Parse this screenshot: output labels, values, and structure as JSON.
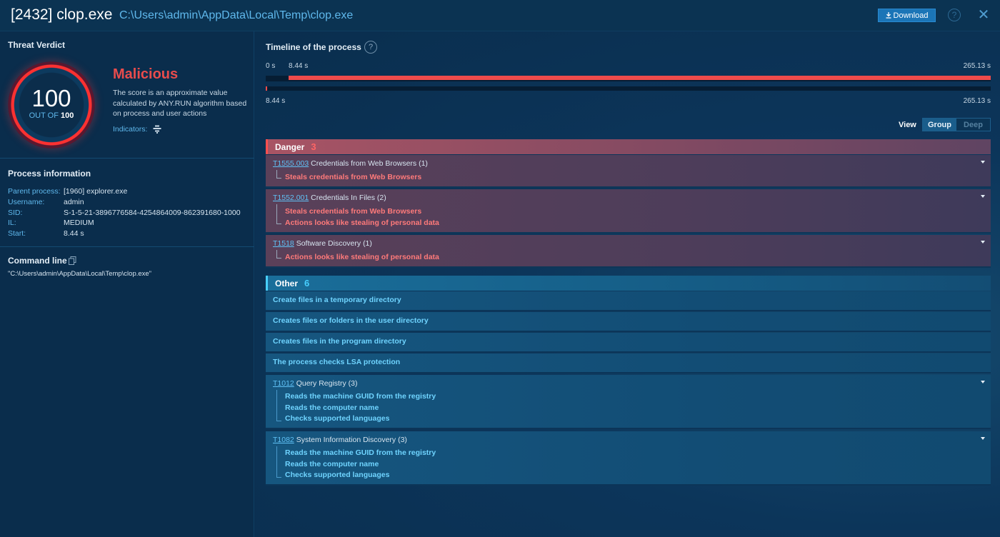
{
  "header": {
    "title": "[2432] clop.exe",
    "path": "C:\\Users\\admin\\AppData\\Local\\Temp\\clop.exe",
    "download_label": "Download",
    "help_glyph": "?",
    "close_glyph": "✕"
  },
  "verdict": {
    "section_title": "Threat Verdict",
    "score": "100",
    "out_of_prefix": "OUT OF",
    "out_of_value": "100",
    "label": "Malicious",
    "description": "The score is an approximate value calculated by ANY.RUN algorithm based on process and user actions",
    "indicators_label": "Indicators:",
    "colors": {
      "malicious": "#e84c4c",
      "ring": "#ff3131"
    }
  },
  "process_info": {
    "section_title": "Process information",
    "rows": [
      {
        "key": "Parent process:",
        "value": "[1960] explorer.exe"
      },
      {
        "key": "Username:",
        "value": "admin"
      },
      {
        "key": "SID:",
        "value": "S-1-5-21-3896776584-4254864009-862391680-1000"
      },
      {
        "key": "IL:",
        "value": "MEDIUM"
      },
      {
        "key": "Start:",
        "value": "8.44 s"
      }
    ]
  },
  "command_line": {
    "section_title": "Command line",
    "value": "\"C:\\Users\\admin\\AppData\\Local\\Temp\\clop.exe\""
  },
  "timeline": {
    "title": "Timeline of the process",
    "start_label": "0 s",
    "marker_label": "8.44 s",
    "end_label": "265.13 s",
    "bottom_start_label": "8.44 s",
    "bottom_end_label": "265.13 s",
    "start_value": 0,
    "process_start": 8.44,
    "end_value": 265.13
  },
  "view": {
    "label": "View",
    "options": [
      "Group",
      "Deep"
    ],
    "selected": "Group"
  },
  "danger": {
    "label": "Danger",
    "count": "3",
    "items": [
      {
        "id": "T1555.003",
        "title": "Credentials from Web Browsers (1)",
        "subs": [
          "Steals credentials from Web Browsers"
        ]
      },
      {
        "id": "T1552.001",
        "title": "Credentials In Files (2)",
        "subs": [
          "Steals credentials from Web Browsers",
          "Actions looks like stealing of personal data"
        ]
      },
      {
        "id": "T1518",
        "title": "Software Discovery (1)",
        "subs": [
          "Actions looks like stealing of personal data"
        ]
      }
    ]
  },
  "other": {
    "label": "Other",
    "count": "6",
    "plain_items": [
      "Create files in a temporary directory",
      "Creates files or folders in the user directory",
      "Creates files in the program directory",
      "The process checks LSA protection"
    ],
    "items": [
      {
        "id": "T1012",
        "title": "Query Registry (3)",
        "subs": [
          "Reads the machine GUID from the registry",
          "Reads the computer name",
          "Checks supported languages"
        ]
      },
      {
        "id": "T1082",
        "title": "System Information Discovery (3)",
        "subs": [
          "Reads the machine GUID from the registry",
          "Reads the computer name",
          "Checks supported languages"
        ]
      }
    ]
  }
}
